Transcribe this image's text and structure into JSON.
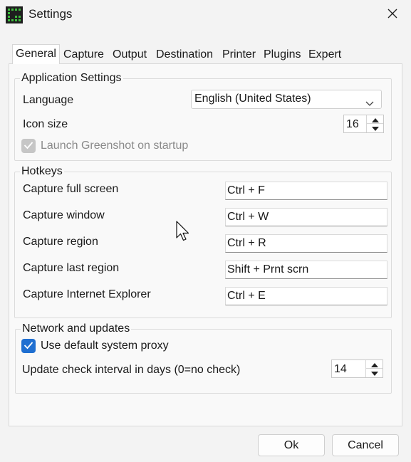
{
  "window": {
    "title": "Settings",
    "icons": {
      "app": "greenshot-icon",
      "close": "close-icon"
    }
  },
  "tabs": [
    {
      "label": "General",
      "active": true
    },
    {
      "label": "Capture",
      "active": false
    },
    {
      "label": "Output",
      "active": false
    },
    {
      "label": "Destination",
      "active": false
    },
    {
      "label": "Printer",
      "active": false
    },
    {
      "label": "Plugins",
      "active": false
    },
    {
      "label": "Expert",
      "active": false
    }
  ],
  "application": {
    "legend": "Application Settings",
    "language_label": "Language",
    "language_value": "English (United States)",
    "icon_size_label": "Icon size",
    "icon_size_value": "16",
    "launch_label": "Launch Greenshot on startup",
    "launch_checked": true,
    "launch_disabled": true
  },
  "hotkeys": {
    "legend": "Hotkeys",
    "rows": [
      {
        "label": "Capture full screen",
        "value": "Ctrl + F"
      },
      {
        "label": "Capture window",
        "value": "Ctrl + W"
      },
      {
        "label": "Capture region",
        "value": "Ctrl + R"
      },
      {
        "label": "Capture last region",
        "value": "Shift + Prnt scrn"
      },
      {
        "label": "Capture Internet Explorer",
        "value": "Ctrl + E"
      }
    ]
  },
  "network": {
    "legend": "Network and updates",
    "proxy_label": "Use default system proxy",
    "proxy_checked": true,
    "interval_label": "Update check interval in days (0=no check)",
    "interval_value": "14"
  },
  "buttons": {
    "ok": "Ok",
    "cancel": "Cancel"
  },
  "colors": {
    "accent": "#1f6fd1",
    "icon_green": "#3dbd3d",
    "background": "#f3f3f3"
  }
}
